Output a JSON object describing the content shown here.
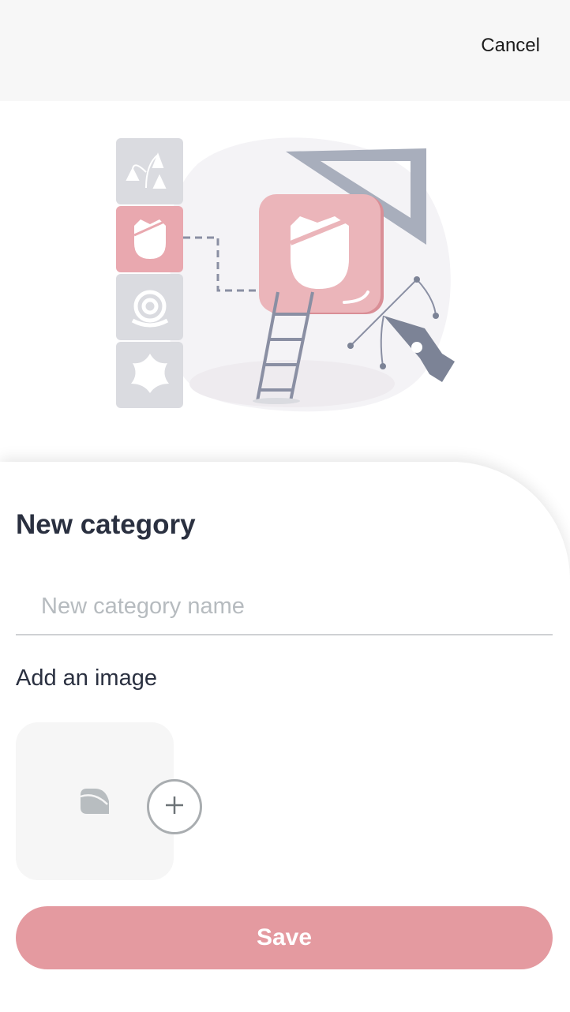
{
  "header": {
    "cancel_label": "Cancel"
  },
  "illustration": {
    "name": "category-illustration"
  },
  "form": {
    "title": "New category",
    "name_placeholder": "New category name",
    "name_value": "",
    "add_image_label": "Add an image",
    "image_placeholder_icon": "image-placeholder-icon",
    "add_image_icon": "plus-icon",
    "save_label": "Save"
  },
  "colors": {
    "accent": "#e49aa0",
    "accent_light": "#ebb5ba",
    "text_dark": "#2a3040",
    "header_bg": "#f7f7f7",
    "tile_gray": "#dadbe0",
    "tool_gray": "#a8aebc"
  }
}
